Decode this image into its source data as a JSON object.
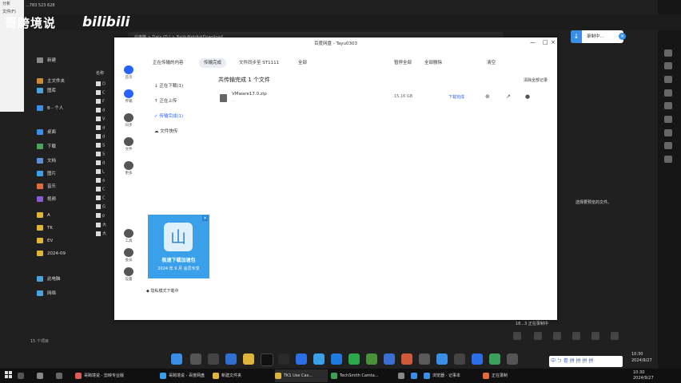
{
  "watermark": {
    "cn": "哥跨境说",
    "logo": "bilibili"
  },
  "explorer": {
    "window_id": "...783 523 628",
    "left_doc_lines": [
      "分析",
      "文件(F)",
      "",
      "",
      "",
      "",
      "",
      "",
      "",
      "",
      "",
      "",
      ""
    ],
    "address_path": "此电脑 > Data (D:) > BaiduNetdiskDownload",
    "sidebar": [
      {
        "label": "新建",
        "color": "#888"
      },
      {
        "label": "主文件夹",
        "color": "#c98a3a"
      },
      {
        "label": "图库",
        "color": "#4aa3df"
      },
      {
        "label": "B - 个人",
        "color": "#3a8ee6"
      },
      {
        "label": "桌面",
        "color": "#3a8ee6"
      },
      {
        "label": "下载",
        "color": "#4aa35f"
      },
      {
        "label": "文档",
        "color": "#5d8fd6"
      },
      {
        "label": "图片",
        "color": "#3aa0ea"
      },
      {
        "label": "音乐",
        "color": "#e06c3a"
      },
      {
        "label": "视频",
        "color": "#8a5bd6"
      },
      {
        "label": "A",
        "color": "#e0b43a"
      },
      {
        "label": "TK",
        "color": "#e0b43a"
      },
      {
        "label": "EV",
        "color": "#e0b43a"
      },
      {
        "label": "2024-09",
        "color": "#e0b43a"
      },
      {
        "label": "此电脑",
        "color": "#4aa3df"
      },
      {
        "label": "网络",
        "color": "#4aa3df"
      }
    ],
    "file_column_header": "名称",
    "files": [
      "D",
      "C",
      "F",
      "d",
      "V",
      "d",
      "d",
      "S",
      "S",
      "d",
      "L",
      "a",
      "C",
      "C",
      "G",
      "p",
      "大",
      "大"
    ],
    "status": "15 个项目",
    "preview_text": "选择要预览的文件。"
  },
  "dialog": {
    "title": "百度网盘 - Tayu0303",
    "tabs": [
      "正在传输的内容",
      "传输完成",
      "文件同步至 ST1111",
      "全部",
      "暂停全部",
      "全部删除",
      "清空"
    ],
    "rail": [
      {
        "label": "首页",
        "icon": "home-icon"
      },
      {
        "label": "传输",
        "icon": "transfer-icon"
      },
      {
        "label": "同步",
        "icon": "sync-icon"
      },
      {
        "label": "文件",
        "icon": "file-icon"
      },
      {
        "label": "更多",
        "icon": "more-icon"
      },
      {
        "label": "工具",
        "icon": "tool-icon"
      },
      {
        "label": "会员",
        "icon": "vip-icon"
      },
      {
        "label": "设置",
        "icon": "settings-icon"
      }
    ],
    "side": [
      {
        "label": "正在下载(1)",
        "active": false
      },
      {
        "label": "正在上传",
        "active": false
      },
      {
        "label": "传输完成(1)",
        "active": true
      },
      {
        "label": "文件快传",
        "active": false
      }
    ],
    "list_heading": "共传输完成 1 个文件",
    "clear_button": "清除全部记录",
    "row": {
      "name": "VMware17.0.zip",
      "sub": "...",
      "size": "15.16 GB",
      "status": "下载完成"
    },
    "promo": {
      "title": "极速下载加速包",
      "sub": "2024 年 9 月 会员专享",
      "close": "×"
    },
    "bottom": "隐私模式下载中"
  },
  "recorder": {
    "label": "录制中...",
    "close": "×",
    "bar_text": "18...3 正在录制中"
  },
  "taskbar": {
    "items": [
      "",
      "",
      "",
      "哥跨境说 - 剪映专业版",
      "哥跨境说 - 百度网盘",
      "新建文件夹",
      "TK1 Use Cas...",
      "TechSmith Camta...",
      "",
      "",
      "浏览器 - 记事本",
      "正在录制"
    ],
    "ime": "中 ㄅ 卷 拼 拼 拼 拼",
    "clock_time": "10:30",
    "clock_date": "2024/9/27"
  }
}
